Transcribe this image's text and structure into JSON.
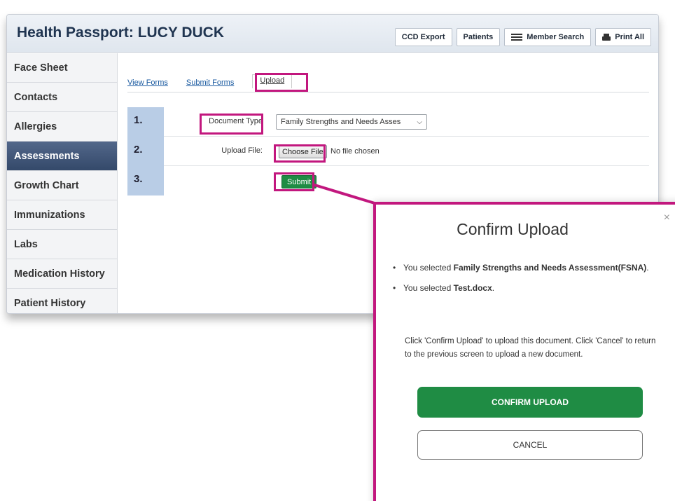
{
  "header": {
    "title": "Health Passport: LUCY DUCK",
    "buttons": {
      "ccd_export": "CCD Export",
      "patients": "Patients",
      "member_search": "Member Search",
      "print_all": "Print All"
    }
  },
  "sidebar": {
    "items": [
      {
        "label": "Face Sheet"
      },
      {
        "label": "Contacts"
      },
      {
        "label": "Allergies"
      },
      {
        "label": "Assessments",
        "active": true
      },
      {
        "label": "Growth Chart"
      },
      {
        "label": "Immunizations"
      },
      {
        "label": "Labs"
      },
      {
        "label": "Medication History"
      },
      {
        "label": "Patient History"
      }
    ]
  },
  "tabs": {
    "view_forms": "View Forms",
    "submit_forms": "Submit Forms",
    "upload": "Upload"
  },
  "form": {
    "rows": [
      {
        "step": "1.",
        "label": "Document Type",
        "select_value": "Family Strengths and Needs Asses"
      },
      {
        "step": "2.",
        "label": "Upload File:",
        "button": "Choose File",
        "status": "No file chosen"
      },
      {
        "step": "3.",
        "submit": "Submit"
      }
    ]
  },
  "modal": {
    "close": "×",
    "title": "Confirm Upload",
    "item1_prefix": "You selected ",
    "item1_value": "Family Strengths and Needs Assessment(FSNA)",
    "item1_suffix": ".",
    "item2_prefix": "You selected ",
    "item2_value": "Test.docx",
    "item2_suffix": ".",
    "description": "Click 'Confirm Upload' to upload this document. Click 'Cancel' to return to the previous screen to upload a new document.",
    "confirm": "CONFIRM UPLOAD",
    "cancel": "CANCEL"
  },
  "colors": {
    "highlight": "#c2177e",
    "active_nav": "#3f5477",
    "step_bg": "#b9cde6",
    "submit_green": "#1f8c44"
  }
}
